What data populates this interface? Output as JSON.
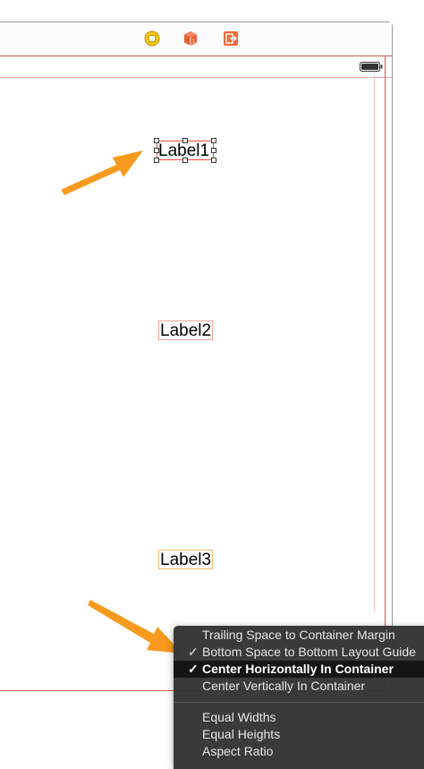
{
  "canvas": {
    "labels": [
      {
        "text": "Label1",
        "selected": true
      },
      {
        "text": "Label2"
      },
      {
        "text": "Label3"
      }
    ]
  },
  "dock": {
    "icons": [
      "view-controller-icon",
      "first-responder-cube-icon",
      "exit-icon"
    ]
  },
  "menu": {
    "items": [
      {
        "label": "Trailing Space to Container Margin",
        "checked": false,
        "highlighted": false
      },
      {
        "label": "Bottom Space to Bottom Layout Guide",
        "checked": true,
        "highlighted": false
      },
      {
        "label": "Center Horizontally In Container",
        "checked": true,
        "highlighted": true
      },
      {
        "label": "Center Vertically In Container",
        "checked": false,
        "highlighted": false
      }
    ],
    "items2": [
      {
        "label": "Equal Widths"
      },
      {
        "label": "Equal Heights"
      },
      {
        "label": "Aspect Ratio"
      }
    ],
    "check_glyph": "✓"
  },
  "colors": {
    "arrow": "#f79a1e",
    "constraint_red": "#d9534f",
    "menu_bg": "#343434"
  }
}
